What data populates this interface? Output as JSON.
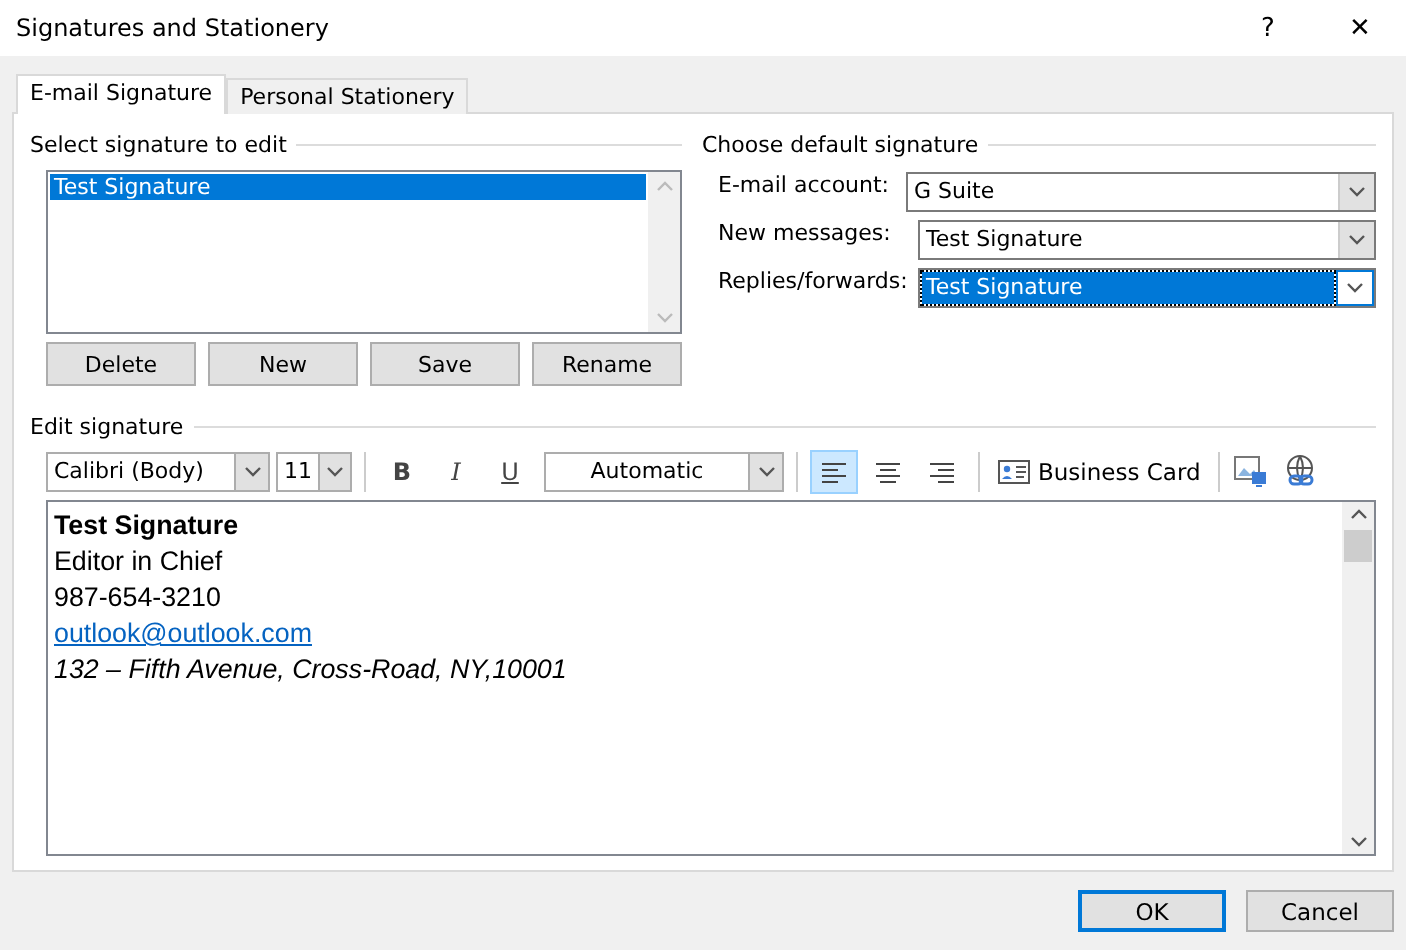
{
  "window": {
    "title": "Signatures and Stationery",
    "help": "?",
    "close": "✕"
  },
  "tabs": [
    {
      "label": "E-mail Signature",
      "selected": true
    },
    {
      "label": "Personal Stationery",
      "selected": false
    }
  ],
  "select_signature": {
    "label": "Select signature to edit",
    "items": [
      {
        "label": "Test Signature",
        "selected": true
      }
    ],
    "buttons": [
      "Delete",
      "New",
      "Save",
      "Rename"
    ]
  },
  "default_signature": {
    "label": "Choose default signature",
    "fields": [
      {
        "label": "E-mail account:",
        "value": "G Suite",
        "focused": false
      },
      {
        "label": "New messages:",
        "value": "Test Signature",
        "focused": false
      },
      {
        "label": "Replies/forwards:",
        "value": "Test Signature",
        "focused": true
      }
    ]
  },
  "edit_signature": {
    "label": "Edit signature",
    "toolbar": {
      "font": "Calibri (Body)",
      "size": "11",
      "format": [
        {
          "kind": "bold",
          "label": "B"
        },
        {
          "kind": "italic",
          "label": "I"
        },
        {
          "kind": "underline",
          "label": "U"
        }
      ],
      "font_color": "Automatic",
      "align": [
        {
          "kind": "left",
          "selected": true
        },
        {
          "kind": "center",
          "selected": false
        },
        {
          "kind": "right",
          "selected": false
        }
      ],
      "business_card": "Business Card"
    },
    "lines": [
      {
        "kind": "bold",
        "text": "Test Signature"
      },
      {
        "kind": "plain",
        "text": "Editor in Chief"
      },
      {
        "kind": "plain",
        "text": "987-654-3210"
      },
      {
        "kind": "link",
        "text": "outlook@outlook.com"
      },
      {
        "kind": "italic",
        "text": "132 – Fifth Avenue, Cross-Road, NY,10001"
      }
    ]
  },
  "buttons": [
    "OK",
    "Cancel"
  ]
}
